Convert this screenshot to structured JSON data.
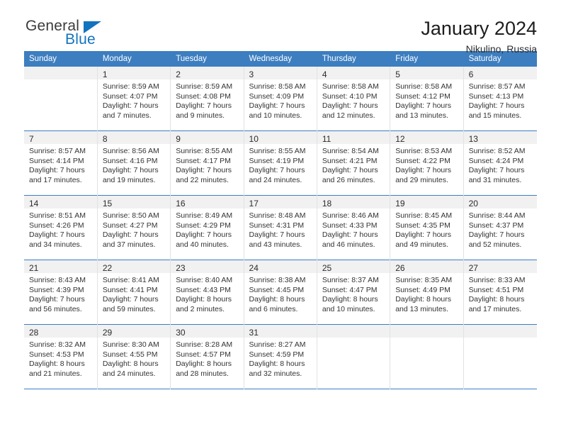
{
  "brand": {
    "name_top": "General",
    "name_bottom": "Blue",
    "triangle_color": "#1273bf",
    "top_color": "#3b3b3b"
  },
  "header": {
    "title": "January 2024",
    "subtitle": "Nikulino, Russia"
  },
  "theme": {
    "header_bg": "#3c7ec0",
    "header_text": "#ffffff",
    "daynum_bg": "#f1f1f1",
    "week_divider": "#3c7ec0",
    "cell_divider": "#e2e2e2"
  },
  "labels": {
    "sunrise_prefix": "Sunrise:",
    "sunset_prefix": "Sunset:",
    "daylight_prefix": "Daylight:"
  },
  "weekday_headers": [
    "Sunday",
    "Monday",
    "Tuesday",
    "Wednesday",
    "Thursday",
    "Friday",
    "Saturday"
  ],
  "weeks": [
    [
      {
        "day": "",
        "lines": []
      },
      {
        "day": "1",
        "lines": [
          "Sunrise: 8:59 AM",
          "Sunset: 4:07 PM",
          "Daylight: 7 hours",
          "and 7 minutes."
        ]
      },
      {
        "day": "2",
        "lines": [
          "Sunrise: 8:59 AM",
          "Sunset: 4:08 PM",
          "Daylight: 7 hours",
          "and 9 minutes."
        ]
      },
      {
        "day": "3",
        "lines": [
          "Sunrise: 8:58 AM",
          "Sunset: 4:09 PM",
          "Daylight: 7 hours",
          "and 10 minutes."
        ]
      },
      {
        "day": "4",
        "lines": [
          "Sunrise: 8:58 AM",
          "Sunset: 4:10 PM",
          "Daylight: 7 hours",
          "and 12 minutes."
        ]
      },
      {
        "day": "5",
        "lines": [
          "Sunrise: 8:58 AM",
          "Sunset: 4:12 PM",
          "Daylight: 7 hours",
          "and 13 minutes."
        ]
      },
      {
        "day": "6",
        "lines": [
          "Sunrise: 8:57 AM",
          "Sunset: 4:13 PM",
          "Daylight: 7 hours",
          "and 15 minutes."
        ]
      }
    ],
    [
      {
        "day": "7",
        "lines": [
          "Sunrise: 8:57 AM",
          "Sunset: 4:14 PM",
          "Daylight: 7 hours",
          "and 17 minutes."
        ]
      },
      {
        "day": "8",
        "lines": [
          "Sunrise: 8:56 AM",
          "Sunset: 4:16 PM",
          "Daylight: 7 hours",
          "and 19 minutes."
        ]
      },
      {
        "day": "9",
        "lines": [
          "Sunrise: 8:55 AM",
          "Sunset: 4:17 PM",
          "Daylight: 7 hours",
          "and 22 minutes."
        ]
      },
      {
        "day": "10",
        "lines": [
          "Sunrise: 8:55 AM",
          "Sunset: 4:19 PM",
          "Daylight: 7 hours",
          "and 24 minutes."
        ]
      },
      {
        "day": "11",
        "lines": [
          "Sunrise: 8:54 AM",
          "Sunset: 4:21 PM",
          "Daylight: 7 hours",
          "and 26 minutes."
        ]
      },
      {
        "day": "12",
        "lines": [
          "Sunrise: 8:53 AM",
          "Sunset: 4:22 PM",
          "Daylight: 7 hours",
          "and 29 minutes."
        ]
      },
      {
        "day": "13",
        "lines": [
          "Sunrise: 8:52 AM",
          "Sunset: 4:24 PM",
          "Daylight: 7 hours",
          "and 31 minutes."
        ]
      }
    ],
    [
      {
        "day": "14",
        "lines": [
          "Sunrise: 8:51 AM",
          "Sunset: 4:26 PM",
          "Daylight: 7 hours",
          "and 34 minutes."
        ]
      },
      {
        "day": "15",
        "lines": [
          "Sunrise: 8:50 AM",
          "Sunset: 4:27 PM",
          "Daylight: 7 hours",
          "and 37 minutes."
        ]
      },
      {
        "day": "16",
        "lines": [
          "Sunrise: 8:49 AM",
          "Sunset: 4:29 PM",
          "Daylight: 7 hours",
          "and 40 minutes."
        ]
      },
      {
        "day": "17",
        "lines": [
          "Sunrise: 8:48 AM",
          "Sunset: 4:31 PM",
          "Daylight: 7 hours",
          "and 43 minutes."
        ]
      },
      {
        "day": "18",
        "lines": [
          "Sunrise: 8:46 AM",
          "Sunset: 4:33 PM",
          "Daylight: 7 hours",
          "and 46 minutes."
        ]
      },
      {
        "day": "19",
        "lines": [
          "Sunrise: 8:45 AM",
          "Sunset: 4:35 PM",
          "Daylight: 7 hours",
          "and 49 minutes."
        ]
      },
      {
        "day": "20",
        "lines": [
          "Sunrise: 8:44 AM",
          "Sunset: 4:37 PM",
          "Daylight: 7 hours",
          "and 52 minutes."
        ]
      }
    ],
    [
      {
        "day": "21",
        "lines": [
          "Sunrise: 8:43 AM",
          "Sunset: 4:39 PM",
          "Daylight: 7 hours",
          "and 56 minutes."
        ]
      },
      {
        "day": "22",
        "lines": [
          "Sunrise: 8:41 AM",
          "Sunset: 4:41 PM",
          "Daylight: 7 hours",
          "and 59 minutes."
        ]
      },
      {
        "day": "23",
        "lines": [
          "Sunrise: 8:40 AM",
          "Sunset: 4:43 PM",
          "Daylight: 8 hours",
          "and 2 minutes."
        ]
      },
      {
        "day": "24",
        "lines": [
          "Sunrise: 8:38 AM",
          "Sunset: 4:45 PM",
          "Daylight: 8 hours",
          "and 6 minutes."
        ]
      },
      {
        "day": "25",
        "lines": [
          "Sunrise: 8:37 AM",
          "Sunset: 4:47 PM",
          "Daylight: 8 hours",
          "and 10 minutes."
        ]
      },
      {
        "day": "26",
        "lines": [
          "Sunrise: 8:35 AM",
          "Sunset: 4:49 PM",
          "Daylight: 8 hours",
          "and 13 minutes."
        ]
      },
      {
        "day": "27",
        "lines": [
          "Sunrise: 8:33 AM",
          "Sunset: 4:51 PM",
          "Daylight: 8 hours",
          "and 17 minutes."
        ]
      }
    ],
    [
      {
        "day": "28",
        "lines": [
          "Sunrise: 8:32 AM",
          "Sunset: 4:53 PM",
          "Daylight: 8 hours",
          "and 21 minutes."
        ]
      },
      {
        "day": "29",
        "lines": [
          "Sunrise: 8:30 AM",
          "Sunset: 4:55 PM",
          "Daylight: 8 hours",
          "and 24 minutes."
        ]
      },
      {
        "day": "30",
        "lines": [
          "Sunrise: 8:28 AM",
          "Sunset: 4:57 PM",
          "Daylight: 8 hours",
          "and 28 minutes."
        ]
      },
      {
        "day": "31",
        "lines": [
          "Sunrise: 8:27 AM",
          "Sunset: 4:59 PM",
          "Daylight: 8 hours",
          "and 32 minutes."
        ]
      },
      {
        "day": "",
        "lines": []
      },
      {
        "day": "",
        "lines": []
      },
      {
        "day": "",
        "lines": []
      }
    ]
  ]
}
